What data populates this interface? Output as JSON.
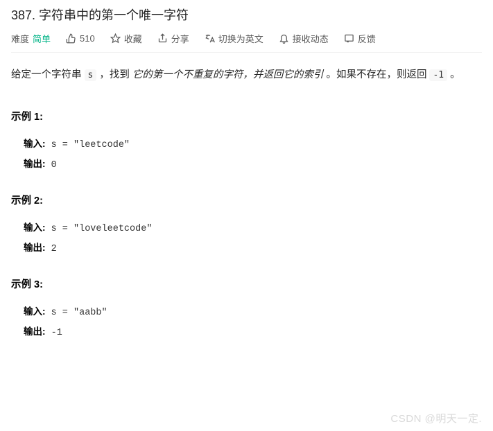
{
  "title": "387. 字符串中的第一个唯一字符",
  "meta": {
    "difficulty_label": "难度",
    "difficulty_value": "简单",
    "likes": "510",
    "favorite": "收藏",
    "share": "分享",
    "switch_lang": "切换为英文",
    "notifications": "接收动态",
    "feedback": "反馈"
  },
  "description": {
    "part1": "给定一个字符串 ",
    "code1": "s",
    "part2": " ，找到 ",
    "italic": "它的第一个不重复的字符，并返回它的索引",
    "part3": " 。如果不存在，则返回 ",
    "code2": "-1",
    "part4": " 。"
  },
  "examples": [
    {
      "title": "示例 1:",
      "input_label": "输入:",
      "input_value": " s = \"leetcode\"",
      "output_label": "输出:",
      "output_value": " 0"
    },
    {
      "title": "示例 2:",
      "input_label": "输入:",
      "input_value": " s = \"loveleetcode\"",
      "output_label": "输出:",
      "output_value": " 2"
    },
    {
      "title": "示例 3:",
      "input_label": "输入:",
      "input_value": " s = \"aabb\"",
      "output_label": "输出:",
      "output_value": " -1"
    }
  ],
  "watermark": "CSDN @明天一定."
}
